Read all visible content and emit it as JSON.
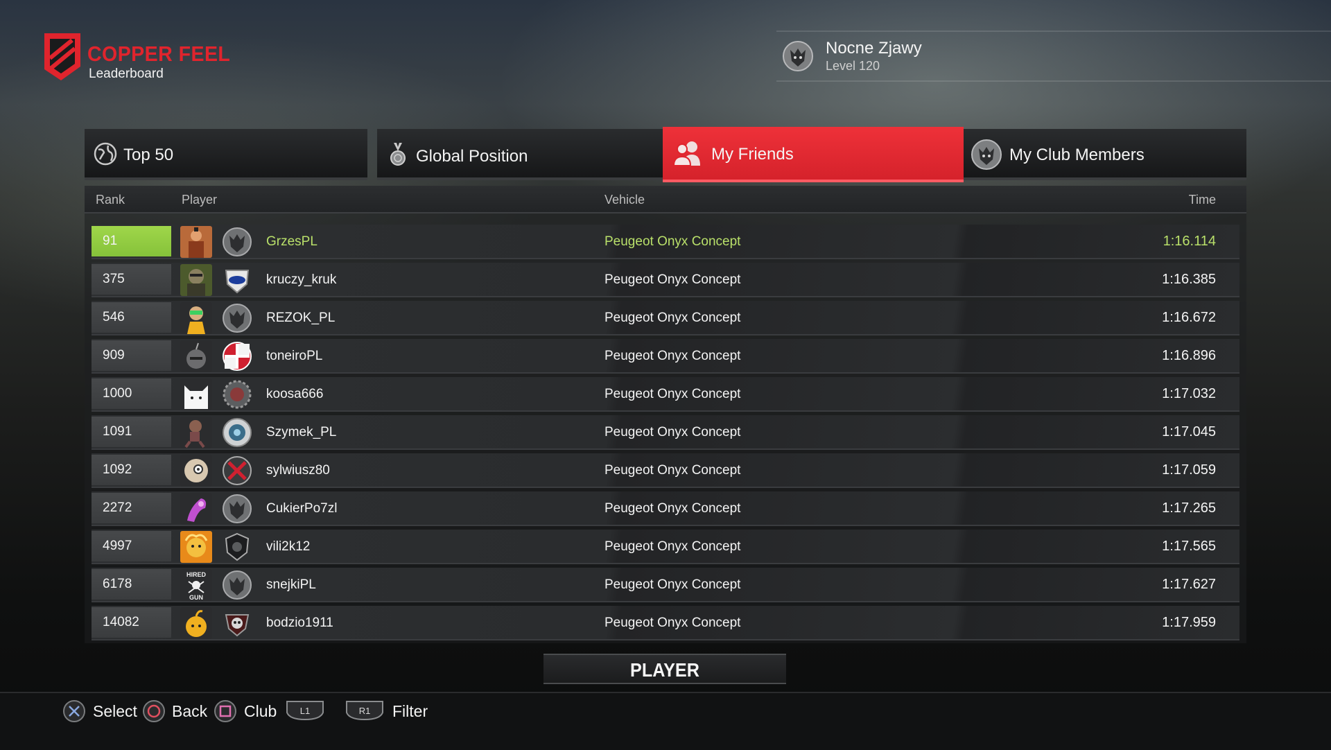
{
  "brand": {
    "name": "COPPER FEEL",
    "subtitle": "Leaderboard",
    "color": "#e0242d"
  },
  "profile": {
    "name": "Nocne Zjawy",
    "level": "Level 120",
    "emblem": "wolf-emblem-icon"
  },
  "tabs": [
    {
      "label": "Top 50",
      "icon": "globe-icon",
      "active": false
    },
    {
      "label": "Global Position",
      "icon": "medal-icon",
      "active": false
    },
    {
      "label": "My Friends",
      "icon": "friends-icon",
      "active": true
    },
    {
      "label": "My Club Members",
      "icon": "wolf-emblem-icon",
      "active": false
    }
  ],
  "columns": {
    "rank": "Rank",
    "player": "Player",
    "vehicle": "Vehicle",
    "time": "Time"
  },
  "rows": [
    {
      "rank": "91",
      "player": "GrzesPL",
      "vehicle": "Peugeot Onyx Concept",
      "time": "1:16.114",
      "highlight": true,
      "avatar": "fighter-avatar",
      "club": "wolf-emblem-icon"
    },
    {
      "rank": "375",
      "player": "kruczy_kruk",
      "vehicle": "Peugeot Onyx Concept",
      "time": "1:16.385",
      "avatar": "soldier-avatar",
      "club": "shield-emblem-icon"
    },
    {
      "rank": "546",
      "player": "REZOK_PL",
      "vehicle": "Peugeot Onyx Concept",
      "time": "1:16.672",
      "avatar": "cartoon-avatar",
      "club": "wolf-emblem-icon"
    },
    {
      "rank": "909",
      "player": "toneiroPL",
      "vehicle": "Peugeot Onyx Concept",
      "time": "1:16.896",
      "avatar": "bomb-avatar",
      "club": "red-cross-emblem-icon"
    },
    {
      "rank": "1000",
      "player": "koosa666",
      "vehicle": "Peugeot Onyx Concept",
      "time": "1:17.032",
      "avatar": "cat-avatar",
      "club": "gear-emblem-icon"
    },
    {
      "rank": "1091",
      "player": "Szymek_PL",
      "vehicle": "Peugeot Onyx Concept",
      "time": "1:17.045",
      "avatar": "sackboy-avatar",
      "club": "target-emblem-icon"
    },
    {
      "rank": "1092",
      "player": "sylwiusz80",
      "vehicle": "Peugeot Onyx Concept",
      "time": "1:17.059",
      "avatar": "creature-avatar",
      "club": "crossed-emblem-icon"
    },
    {
      "rank": "2272",
      "player": "CukierPo7zl",
      "vehicle": "Peugeot Onyx Concept",
      "time": "1:17.265",
      "avatar": "purple-avatar",
      "club": "wolf-emblem-icon"
    },
    {
      "rank": "4997",
      "player": "vili2k12",
      "vehicle": "Peugeot Onyx Concept",
      "time": "1:17.565",
      "avatar": "fire-avatar",
      "club": "dark-shield-emblem-icon"
    },
    {
      "rank": "6178",
      "player": "snejkiPL",
      "vehicle": "Peugeot Onyx Concept",
      "time": "1:17.627",
      "avatar": "hired-gun-avatar",
      "hired_gun": [
        "HIRED",
        "GUN"
      ],
      "club": "wolf-emblem-icon"
    },
    {
      "rank": "14082",
      "player": "bodzio1911",
      "vehicle": "Peugeot Onyx Concept",
      "time": "1:17.959",
      "avatar": "fruit-avatar",
      "club": "skull-emblem-icon"
    }
  ],
  "filter_badge": "PLAYER",
  "hints": [
    {
      "button": "cross-button-icon",
      "label": "Select"
    },
    {
      "button": "circle-button-icon",
      "label": "Back"
    },
    {
      "button": "square-button-icon",
      "label": "Club"
    },
    {
      "button": "L1",
      "label": ""
    },
    {
      "button": "R1",
      "label": "Filter"
    }
  ],
  "colors": {
    "active_tab": "#e0242d",
    "highlight_row": "#8fcb41",
    "highlight_text": "#b9e06a"
  }
}
